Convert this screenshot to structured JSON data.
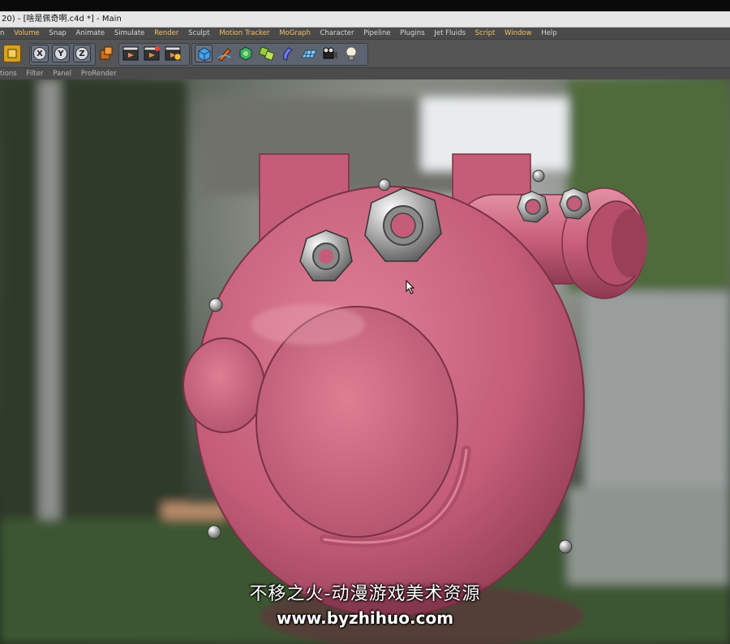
{
  "window": {
    "title": "20) - [啥是佩奇啊.c4d *] - Main"
  },
  "menubar": {
    "items": [
      "n",
      "Volume",
      "Snap",
      "Animate",
      "Simulate",
      "Render",
      "Sculpt",
      "Motion Tracker",
      "MoGraph",
      "Character",
      "Pipeline",
      "Plugins",
      "Jet Fluids",
      "Script",
      "Window",
      "Help"
    ]
  },
  "toolbar": {
    "axis_x": "X",
    "axis_y": "Y",
    "axis_z": "Z"
  },
  "subbar": {
    "items": [
      "tions",
      "Filter",
      "Panel",
      "ProRender"
    ]
  },
  "watermark": {
    "line1": "不移之火-动漫游戏美术资源",
    "line2": "www.byzhihuo.com"
  },
  "colors": {
    "model_pink": "#c9607a",
    "menu_highlight": "#f0c060",
    "toolbar_bg": "#555555"
  }
}
